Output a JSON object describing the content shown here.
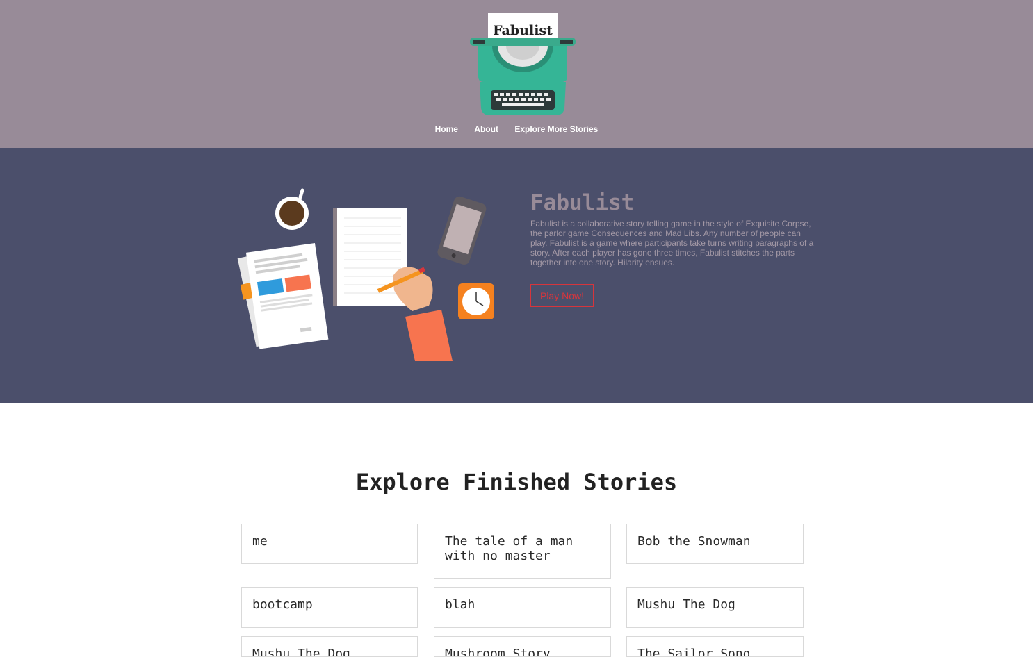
{
  "header": {
    "logo_text": "Fabulist",
    "nav": [
      {
        "label": "Home"
      },
      {
        "label": "About"
      },
      {
        "label": "Explore More Stories"
      }
    ]
  },
  "hero": {
    "title": "Fabulist",
    "description": "Fabulist is a collaborative story telling game in the style of Exquisite Corpse, the parlor game Consequences and Mad Libs. Any number of people can play. Fabulist is a game where participants take turns writing paragraphs of a story. After each player has gone three times, Fabulist stitches the parts together into one story. Hilarity ensues.",
    "play_button": "Play Now!"
  },
  "stories": {
    "title": "Explore Finished Stories",
    "items": [
      {
        "title": "me"
      },
      {
        "title": "The tale of a man with no master"
      },
      {
        "title": "Bob the Snowman"
      },
      {
        "title": "bootcamp"
      },
      {
        "title": "blah"
      },
      {
        "title": "Mushu The Dog"
      },
      {
        "title": "Mushu The Dog"
      },
      {
        "title": "Mushroom Story"
      },
      {
        "title": "The Sailor Song"
      }
    ]
  },
  "colors": {
    "header_bg": "#988b98",
    "hero_bg": "#4b4f6b",
    "accent_red": "#d7353c",
    "teal": "#35b596"
  }
}
